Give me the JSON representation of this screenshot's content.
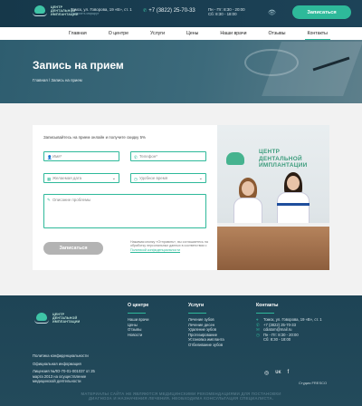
{
  "header": {
    "logo_line1": "ЦЕНТР",
    "logo_line2": "ДЕНТАЛЬНОЙ",
    "logo_line3": "ИМПЛАНТАЦИИ",
    "address": "Томск, ул. Говорова, 19 «В», ст. 1",
    "address_link": "Построить маршрут",
    "phone": "+7 (3822) 25-70-33",
    "hours_weekdays": "Пн - Пт: 8:30 - 20:00",
    "hours_saturday": "Сб: 8:30 - 18:00",
    "cta_label": "Записаться"
  },
  "nav": {
    "items": [
      "Главная",
      "О центре",
      "Услуги",
      "Цены",
      "Наши врачи",
      "Отзывы",
      "Контакты"
    ],
    "active_index": 6
  },
  "hero": {
    "title": "Запись на прием",
    "breadcrumb": "Главная / Запись на прием"
  },
  "form": {
    "subtitle": "Записывайтесь на прием онлайн и получите скидку 5%",
    "name_placeholder": "Имя*",
    "phone_placeholder": "Телефон*",
    "date_placeholder": "Желаемая дата",
    "time_placeholder": "Удобное время",
    "desc_placeholder": "Описание проблемы",
    "submit_label": "Записаться",
    "consent_text": "Нажимая кнопку «Отправить», вы соглашаетесь на обработку персональных данных в соответствии с",
    "consent_link": "Политикой конфиденциальности"
  },
  "photo": {
    "sign_line1": "ЦЕНТР",
    "sign_line2": "ДЕНТАЛЬНОЙ",
    "sign_line3": "ИМПЛАНТАЦИИ"
  },
  "footer": {
    "logo_line1": "ЦЕНТР",
    "logo_line2": "ДЕНТАЛЬНОЙ",
    "logo_line3": "ИМПЛАНТАЦИИ",
    "legal": {
      "privacy": "Политика конфиденциальности",
      "official": "Официальная информация",
      "license": "Лицензия №ЛО-70-01-001037 от 25 марта 2013 на осуществление медицинской деятельности"
    },
    "about": {
      "title": "О центре",
      "items": [
        "Наши врачи",
        "Цены",
        "Отзывы",
        "Новости"
      ]
    },
    "services": {
      "title": "Услуги",
      "items": [
        "Лечение зубов",
        "Лечение десен",
        "Удаление зубов",
        "Протезирование",
        "Установка импланта",
        "Отбеливание зубов"
      ]
    },
    "contacts": {
      "title": "Контакты",
      "address": "Томск, ул. Говорова, 19 «В», ст. 1",
      "phone": "+7 (3822) 25-70-33",
      "email": "cdiatom@mail.ru",
      "hours_weekdays": "Пн - Пт: 8:30 - 20:00",
      "hours_saturday": "Сб: 8:30 - 18:00"
    },
    "studio": "Студия FRESCO",
    "disclaimer_line1": "МАТЕРИАЛЫ САЙТА НЕ ЯВЛЯЮТСЯ МЕДИЦИНСКИМИ РЕКОМЕНДАЦИЯМИ ДЛЯ ПОСТАНОВКИ",
    "disclaimer_line2": "ДИАГНОЗА И НАЗНАЧЕНИЯ ЛЕЧЕНИЯ. НЕОБХОДИМА КОНСУЛЬТАЦИЯ СПЕЦИАЛИСТА."
  },
  "colors": {
    "accent": "#2eb99a",
    "header_bg": "#16384a",
    "footer_bg": "#1e4455",
    "button_disabled": "#b3b3b3"
  }
}
